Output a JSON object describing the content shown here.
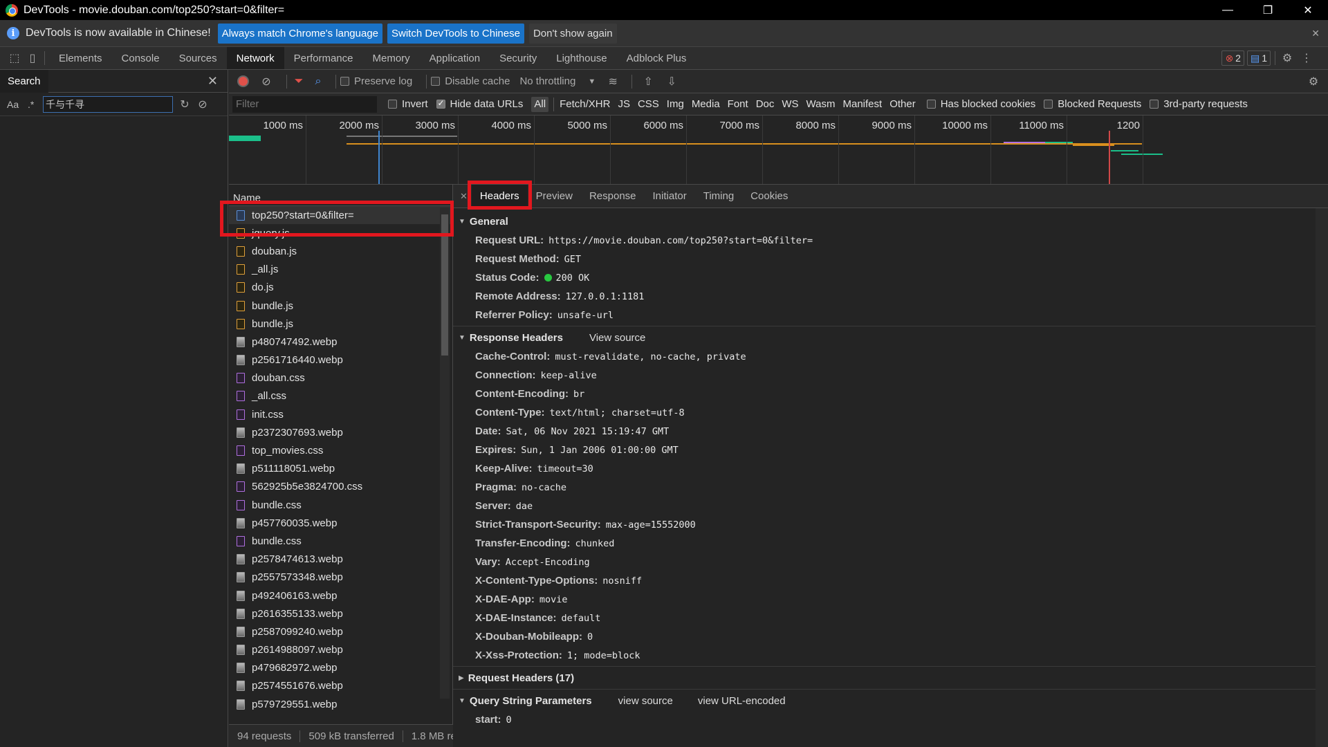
{
  "window": {
    "title": "DevTools - movie.douban.com/top250?start=0&filter=",
    "minimize": "—",
    "maximize": "❐",
    "close": "✕"
  },
  "infobar": {
    "message": "DevTools is now available in Chinese!",
    "btn_match": "Always match Chrome's language",
    "btn_switch": "Switch DevTools to Chinese",
    "btn_dismiss": "Don't show again"
  },
  "tabs": [
    "Elements",
    "Console",
    "Sources",
    "Network",
    "Performance",
    "Memory",
    "Application",
    "Security",
    "Lighthouse",
    "Adblock Plus"
  ],
  "badges": {
    "errors": "2",
    "messages": "1"
  },
  "search": {
    "label": "Search",
    "aa": "Aa",
    "regex": ".*",
    "query": "千与千寻"
  },
  "netbar": {
    "preserve_log": "Preserve log",
    "disable_cache": "Disable cache",
    "throttling": "No throttling"
  },
  "filterbar": {
    "placeholder": "Filter",
    "invert": "Invert",
    "hide_data_urls": "Hide data URLs",
    "types": [
      "All",
      "Fetch/XHR",
      "JS",
      "CSS",
      "Img",
      "Media",
      "Font",
      "Doc",
      "WS",
      "Wasm",
      "Manifest",
      "Other"
    ],
    "has_blocked_cookies": "Has blocked cookies",
    "blocked_requests": "Blocked Requests",
    "third_party": "3rd-party requests"
  },
  "timeline": {
    "ticks": [
      "1000 ms",
      "2000 ms",
      "3000 ms",
      "4000 ms",
      "5000 ms",
      "6000 ms",
      "7000 ms",
      "8000 ms",
      "9000 ms",
      "10000 ms",
      "11000 ms",
      "1200"
    ]
  },
  "requests": {
    "header": "Name",
    "items": [
      {
        "name": "top250?start=0&filter=",
        "type": "doc"
      },
      {
        "name": "jquery.js",
        "type": "js"
      },
      {
        "name": "douban.js",
        "type": "js"
      },
      {
        "name": "_all.js",
        "type": "js"
      },
      {
        "name": "do.js",
        "type": "js"
      },
      {
        "name": "bundle.js",
        "type": "js"
      },
      {
        "name": "bundle.js",
        "type": "js"
      },
      {
        "name": "p480747492.webp",
        "type": "img"
      },
      {
        "name": "p2561716440.webp",
        "type": "img"
      },
      {
        "name": "douban.css",
        "type": "css"
      },
      {
        "name": "_all.css",
        "type": "css"
      },
      {
        "name": "init.css",
        "type": "css"
      },
      {
        "name": "p2372307693.webp",
        "type": "img"
      },
      {
        "name": "top_movies.css",
        "type": "css"
      },
      {
        "name": "p511118051.webp",
        "type": "img"
      },
      {
        "name": "562925b5e3824700.css",
        "type": "css"
      },
      {
        "name": "bundle.css",
        "type": "css"
      },
      {
        "name": "p457760035.webp",
        "type": "img"
      },
      {
        "name": "bundle.css",
        "type": "css"
      },
      {
        "name": "p2578474613.webp",
        "type": "img"
      },
      {
        "name": "p2557573348.webp",
        "type": "img"
      },
      {
        "name": "p492406163.webp",
        "type": "img"
      },
      {
        "name": "p2616355133.webp",
        "type": "img"
      },
      {
        "name": "p2587099240.webp",
        "type": "img"
      },
      {
        "name": "p2614988097.webp",
        "type": "img"
      },
      {
        "name": "p479682972.webp",
        "type": "img"
      },
      {
        "name": "p2574551676.webp",
        "type": "img"
      },
      {
        "name": "p579729551.webp",
        "type": "img"
      }
    ]
  },
  "status": {
    "requests": "94 requests",
    "transferred": "509 kB transferred",
    "resources": "1.8 MB re"
  },
  "detail_tabs": [
    "Headers",
    "Preview",
    "Response",
    "Initiator",
    "Timing",
    "Cookies"
  ],
  "general": {
    "title": "General",
    "rows": [
      {
        "k": "Request URL:",
        "v": "https://movie.douban.com/top250?start=0&filter="
      },
      {
        "k": "Request Method:",
        "v": "GET"
      },
      {
        "k": "Status Code:",
        "v": "200 OK"
      },
      {
        "k": "Remote Address:",
        "v": "127.0.0.1:1181"
      },
      {
        "k": "Referrer Policy:",
        "v": "unsafe-url"
      }
    ]
  },
  "response_headers": {
    "title": "Response Headers",
    "view_source": "View source",
    "rows": [
      {
        "k": "Cache-Control:",
        "v": "must-revalidate, no-cache, private"
      },
      {
        "k": "Connection:",
        "v": "keep-alive"
      },
      {
        "k": "Content-Encoding:",
        "v": "br"
      },
      {
        "k": "Content-Type:",
        "v": "text/html; charset=utf-8"
      },
      {
        "k": "Date:",
        "v": "Sat, 06 Nov 2021 15:19:47 GMT"
      },
      {
        "k": "Expires:",
        "v": "Sun, 1 Jan 2006 01:00:00 GMT"
      },
      {
        "k": "Keep-Alive:",
        "v": "timeout=30"
      },
      {
        "k": "Pragma:",
        "v": "no-cache"
      },
      {
        "k": "Server:",
        "v": "dae"
      },
      {
        "k": "Strict-Transport-Security:",
        "v": "max-age=15552000"
      },
      {
        "k": "Transfer-Encoding:",
        "v": "chunked"
      },
      {
        "k": "Vary:",
        "v": "Accept-Encoding"
      },
      {
        "k": "X-Content-Type-Options:",
        "v": "nosniff"
      },
      {
        "k": "X-DAE-App:",
        "v": "movie"
      },
      {
        "k": "X-DAE-Instance:",
        "v": "default"
      },
      {
        "k": "X-Douban-Mobileapp:",
        "v": "0"
      },
      {
        "k": "X-Xss-Protection:",
        "v": "1; mode=block"
      }
    ]
  },
  "request_headers": {
    "title": "Request Headers (17)"
  },
  "query_params": {
    "title": "Query String Parameters",
    "view_source": "view source",
    "view_url_encoded": "view URL-encoded",
    "rows": [
      {
        "k": "start:",
        "v": "0"
      }
    ]
  },
  "colors": {
    "highlight": "#e2171e",
    "accent": "#1a73c8",
    "status_ok": "#28c840"
  }
}
